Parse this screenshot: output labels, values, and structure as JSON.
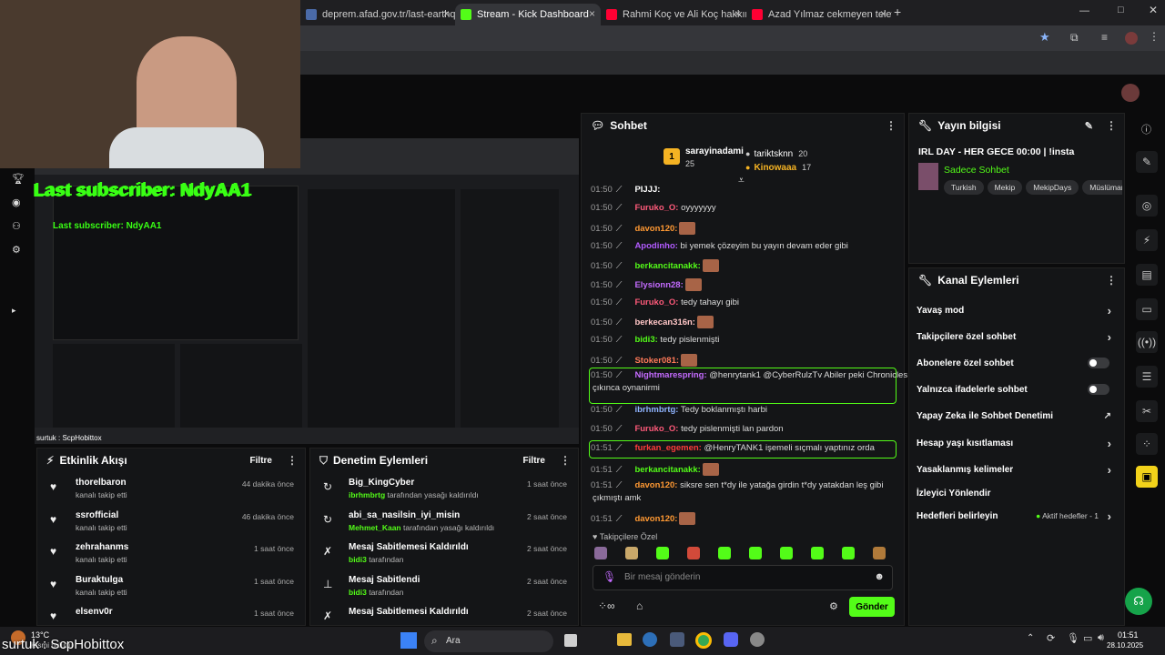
{
  "browser_tabs": [
    {
      "title": "deprem.afad.gov.tr/last-earthq",
      "active": false,
      "favicon": "#4a6aa8"
    },
    {
      "title": "Stream - Kick Dashboard",
      "active": true,
      "favicon": "#53fc18"
    },
    {
      "title": "Rahmi Koç ve Ali Koç hakkında",
      "active": false,
      "favicon": "#ff0033"
    },
    {
      "title": "Azad Yılmaz cekmeyen telefon",
      "active": false,
      "favicon": "#ff0033"
    }
  ],
  "overlay": {
    "last_subscriber": "Last subscriber: NdyAA1",
    "last_subscriber_inner": "Last subscriber: NdyAA1",
    "bottom_name": "surtuk : ScpHobittox",
    "bottom_name_inner": "surtuk : ScpHobittox"
  },
  "activity": {
    "title": "Etkinlik Akışı",
    "filter": "Filtre",
    "rows": [
      {
        "name": "thorelbaron",
        "sub": "kanalı takip etti",
        "time": "44 dakika önce"
      },
      {
        "name": "ssrofficial",
        "sub": "kanalı takip etti",
        "time": "46 dakika önce"
      },
      {
        "name": "zehrahanms",
        "sub": "kanalı takip etti",
        "time": "1 saat önce"
      },
      {
        "name": "Buraktulga",
        "sub": "kanalı takip etti",
        "time": "1 saat önce"
      },
      {
        "name": "elsenv0r",
        "sub": "",
        "time": "1 saat önce"
      }
    ]
  },
  "moderation": {
    "title": "Denetim Eylemleri",
    "filter": "Filtre",
    "rows": [
      {
        "icon": "↻",
        "name": "Big_KingCyber",
        "actor": "ibrhmbrtg",
        "sub": " tarafından yasağı kaldırıldı",
        "time": "1 saat önce"
      },
      {
        "icon": "↻",
        "name": "abi_sa_nasilsin_iyi_misin",
        "actor": "Mehmet_Kaan",
        "sub": " tarafından yasağı kaldırıldı",
        "time": "2 saat önce"
      },
      {
        "icon": "✗",
        "name": "Mesaj Sabitlemesi Kaldırıldı",
        "actor": "bidi3",
        "sub": " tarafından",
        "time": "2 saat önce"
      },
      {
        "icon": "⊥",
        "name": "Mesaj Sabitlendi",
        "actor": "bidi3",
        "sub": " tarafından",
        "time": "2 saat önce"
      },
      {
        "icon": "✗",
        "name": "Mesaj Sabitlemesi Kaldırıldı",
        "actor": "",
        "sub": "",
        "time": "2 saat önce"
      }
    ]
  },
  "chat": {
    "title": "Sohbet",
    "top": [
      {
        "rank": "1",
        "name": "sarayinadami",
        "count": "25"
      },
      {
        "rank": "",
        "name": "tariktsknn",
        "count": "20"
      },
      {
        "rank": "",
        "name": "Kinowaaa",
        "count": "17"
      }
    ],
    "messages": [
      {
        "time": "01:50",
        "user": "PIJJJ:",
        "color": "#ffffff",
        "text": "",
        "emote": false,
        "highlight": false
      },
      {
        "time": "01:50",
        "user": "Furuko_O:",
        "color": "#ff5a7a",
        "text": " oyyyyyyy",
        "emote": false,
        "highlight": false
      },
      {
        "time": "01:50",
        "user": "davon120:",
        "color": "#ff9933",
        "text": "",
        "emote": true,
        "highlight": false
      },
      {
        "time": "01:50",
        "user": "Apodinho:",
        "color": "#b25bff",
        "text": " bi yemek çözeyim bu yayın devam eder gibi",
        "emote": false,
        "highlight": false
      },
      {
        "time": "01:50",
        "user": "berkancitanakk:",
        "color": "#53fc18",
        "text": "",
        "emote": true,
        "highlight": false
      },
      {
        "time": "01:50",
        "user": "Elysionn28:",
        "color": "#c46bff",
        "text": "",
        "emote": true,
        "highlight": false
      },
      {
        "time": "01:50",
        "user": "Furuko_O:",
        "color": "#ff5a7a",
        "text": " tedy tahayı gibi",
        "emote": false,
        "highlight": false
      },
      {
        "time": "01:50",
        "user": "berkecan316n:",
        "color": "#ffc6c6",
        "text": "",
        "emote": true,
        "highlight": false
      },
      {
        "time": "01:50",
        "user": "bidi3:",
        "color": "#53fc18",
        "text": " tedy pislenmişti",
        "emote": false,
        "highlight": false
      },
      {
        "time": "01:50",
        "user": "Stoker081:",
        "color": "#ff7a59",
        "text": "",
        "emote": true,
        "highlight": false
      },
      {
        "time": "01:50",
        "user": "Nightmarespring:",
        "color": "#c46bff",
        "text": " @henrytank1 @CyberRulzTv Abiler peki Chronicles",
        "text2": "çıkınca oynanirmi",
        "emote": false,
        "highlight": true
      },
      {
        "time": "01:50",
        "user": "ibrhmbrtg:",
        "color": "#8fb4ff",
        "text": " Tedy boklanmıştı harbi",
        "emote": false,
        "highlight": false
      },
      {
        "time": "01:50",
        "user": "Furuko_O:",
        "color": "#ff5a7a",
        "text": " tedy pislenmişti lan pardon",
        "emote": false,
        "highlight": false
      },
      {
        "time": "01:51",
        "user": "furkan_egemen:",
        "color": "#ff3b3b",
        "text": " @HenryTANK1 işemeli sıçmalı yaptınız orda",
        "emote": false,
        "highlight": true
      },
      {
        "time": "01:51",
        "user": "berkancitanakk:",
        "color": "#53fc18",
        "text": "",
        "emote": true,
        "highlight": false
      },
      {
        "time": "01:51",
        "user": "davon120:",
        "color": "#ff9933",
        "text": " siksre sen t*dy ile yatağa girdin t*dy yatakdan leş gibi",
        "text2": "çıkmıştı amk",
        "emote": false,
        "highlight": false
      },
      {
        "time": "01:51",
        "user": "davon120:",
        "color": "#ff9933",
        "text": "",
        "emote": true,
        "highlight": false
      }
    ],
    "emote_section": "Takipçilere Özel",
    "input_placeholder": "Bir mesaj gönderin",
    "send_label": "Gönder"
  },
  "stream_info": {
    "title": "Yayın bilgisi",
    "stream_title": "IRL DAY - HER GECE 00:00 | !insta",
    "mode": "Sadece Sohbet",
    "tags": [
      "Turkish",
      "Mekip",
      "MekipDays",
      "Müslüman"
    ]
  },
  "channel_actions": {
    "title": "Kanal Eylemleri",
    "items": [
      {
        "label": "Yavaş mod",
        "control": "arrow"
      },
      {
        "label": "Takipçilere özel sohbet",
        "control": "arrow"
      },
      {
        "label": "Abonelere özel sohbet",
        "control": "toggle"
      },
      {
        "label": "Yalnızca ifadelerle sohbet",
        "control": "toggle"
      },
      {
        "label": "Yapay Zeka ile Sohbet Denetimi",
        "control": "external"
      },
      {
        "label": "Hesap yaşı kısıtlaması",
        "control": "arrow"
      },
      {
        "label": "Yasaklanmış kelimeler",
        "control": "arrow"
      },
      {
        "label": "İzleyici Yönlendir",
        "control": "none"
      },
      {
        "label": "Hedefleri belirleyin",
        "control": "goal"
      }
    ],
    "goal_status": "Aktif hedefler - 1"
  },
  "taskbar": {
    "weather": "13°C",
    "weather_sub": "Kısmi bulutlu",
    "search": "Ara",
    "time": "01:51",
    "date": "28.10.2025"
  },
  "colors": {
    "kick_green": "#53fc18",
    "panel": "#141517",
    "bg": "#0b0b0c"
  }
}
